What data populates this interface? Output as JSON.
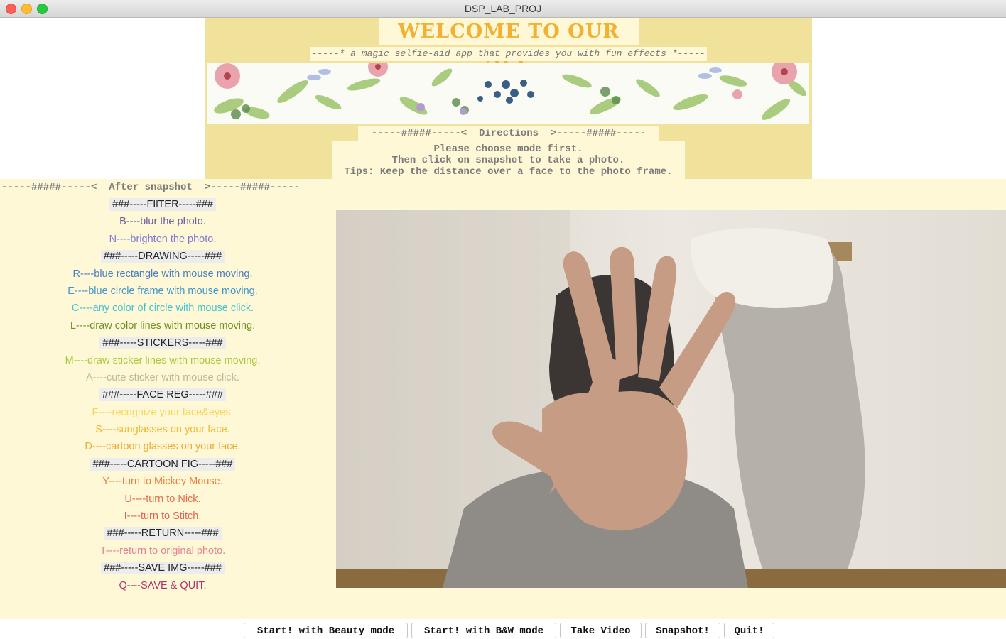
{
  "window": {
    "title": "DSP_LAB_PROJ"
  },
  "header": {
    "welcome": "WELCOME TO OUR APP",
    "subtitle": "-----* a magic selfie-aid app that provides you with fun effects *-----",
    "directions_title": "-----#####-----<  Directions  >-----#####-----",
    "directions": [
      "Please choose mode first.",
      "Then click on snapshot to take a photo.",
      "Tips: Keep the distance over a face to the photo frame."
    ]
  },
  "after_snapshot": {
    "title": "-----#####-----<  After snapshot  >-----#####-----",
    "items": [
      {
        "text": "###-----FIlTER-----###",
        "section": true,
        "color": "#222222"
      },
      {
        "text": "B----blur the photo.",
        "section": false,
        "color": "#6b5a9a"
      },
      {
        "text": "N----brighten the photo.",
        "section": false,
        "color": "#7f78d8"
      },
      {
        "text": "###-----DRAWING-----###",
        "section": true,
        "color": "#222222"
      },
      {
        "text": "R----blue rectangle with mouse moving.",
        "section": false,
        "color": "#4a7fc0"
      },
      {
        "text": "E----blue circle frame with mouse moving.",
        "section": false,
        "color": "#3e96c9"
      },
      {
        "text": "C----any color of circle with mouse click.",
        "section": false,
        "color": "#3fc4cf"
      },
      {
        "text": "L----draw color lines with mouse moving.",
        "section": false,
        "color": "#6f8f27"
      },
      {
        "text": "###-----STICKERS-----###",
        "section": true,
        "color": "#222222"
      },
      {
        "text": "M----draw sticker lines with mouse moving.",
        "section": false,
        "color": "#a8c93e"
      },
      {
        "text": "A----cute sticker with mouse click.",
        "section": false,
        "color": "#b9b98f"
      },
      {
        "text": "###-----FACE REG-----###",
        "section": true,
        "color": "#222222"
      },
      {
        "text": "F----recognize your face&eyes.",
        "section": false,
        "color": "#f2d75a"
      },
      {
        "text": "S----sunglasses on your face.",
        "section": false,
        "color": "#f0b733"
      },
      {
        "text": "D----cartoon glasses on your face.",
        "section": false,
        "color": "#ecaa33"
      },
      {
        "text": "###-----CARTOON FIG-----###",
        "section": true,
        "color": "#222222"
      },
      {
        "text": "Y----turn to Mickey Mouse.",
        "section": false,
        "color": "#ef7d3a"
      },
      {
        "text": "U----turn to Nick.",
        "section": false,
        "color": "#ea6a46"
      },
      {
        "text": "I----turn to Stitch.",
        "section": false,
        "color": "#e5624f"
      },
      {
        "text": "###-----RETURN-----###",
        "section": true,
        "color": "#222222"
      },
      {
        "text": "T----return to original photo.",
        "section": false,
        "color": "#e08296"
      },
      {
        "text": "###-----SAVE IMG-----###",
        "section": true,
        "color": "#222222"
      },
      {
        "text": "Q----SAVE & QUIT.",
        "section": false,
        "color": "#b0306a"
      }
    ]
  },
  "buttons": {
    "beauty": "Start! with Beauty mode",
    "bw": "Start! with B&W mode",
    "video": "Take Video",
    "snapshot": "Snapshot!",
    "quit": "Quit!"
  },
  "colors": {
    "header_bg": "#f0e19b",
    "panel_bg": "#fff8d6",
    "welcome": "#f2b133"
  }
}
